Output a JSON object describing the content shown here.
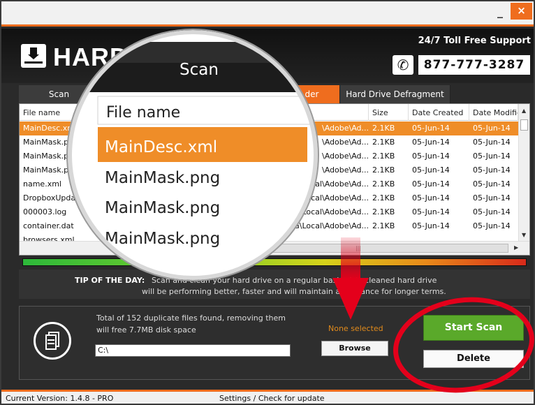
{
  "window": {
    "minimize": "_",
    "close": "×"
  },
  "header": {
    "logo_text": "HARD",
    "support": "24/7 Toll Free Support",
    "phone": "877-777-3287"
  },
  "tabs": [
    {
      "label": "Scan"
    },
    {
      "label": "der"
    },
    {
      "label": "Hard Drive Defragment"
    }
  ],
  "columns": [
    "File name",
    "Size",
    "Date Created",
    "Date Modifie"
  ],
  "files": [
    {
      "name": "MainDesc.xml",
      "path": "\\Adobe\\Ad...",
      "size": "2.1KB",
      "created": "05-Jun-14",
      "modified": "05-Jun-14"
    },
    {
      "name": "MainMask.pr",
      "path": "\\Adobe\\Ad...",
      "size": "2.1KB",
      "created": "05-Jun-14",
      "modified": "05-Jun-14"
    },
    {
      "name": "MainMask.pr",
      "path": "\\Adobe\\Ad...",
      "size": "2.1KB",
      "created": "05-Jun-14",
      "modified": "05-Jun-14"
    },
    {
      "name": "MainMask.pn",
      "path": "\\Adobe\\Ad...",
      "size": "2.1KB",
      "created": "05-Jun-14",
      "modified": "05-Jun-14"
    },
    {
      "name": "name.xml",
      "path": "al\\Adobe\\Ad...",
      "size": "2.1KB",
      "created": "05-Jun-14",
      "modified": "05-Jun-14"
    },
    {
      "name": "DropboxUpdate",
      "path": "Local\\Adobe\\Ad...",
      "size": "2.1KB",
      "created": "05-Jun-14",
      "modified": "05-Jun-14"
    },
    {
      "name": "000003.log",
      "path": "Local\\Adobe\\Ad...",
      "size": "2.1KB",
      "created": "05-Jun-14",
      "modified": "05-Jun-14"
    },
    {
      "name": "container.dat",
      "path": "ta\\Local\\Adobe\\Ad...",
      "size": "2.1KB",
      "created": "05-Jun-14",
      "modified": "05-Jun-14"
    },
    {
      "name": "browsers.xml",
      "path": "",
      "size": "",
      "created": "",
      "modified": ""
    }
  ],
  "zoom": {
    "tab": "Scan",
    "header": "File name",
    "rows": [
      "MainDesc.xml",
      "MainMask.png",
      "MainMask.png",
      "MainMask.png"
    ]
  },
  "tip": {
    "label": "TIP OF THE DAY:",
    "line1": "Scan and clean your hard drive on a regular basis. A      ly cleaned hard drive",
    "line2": "will be performing better, faster and will maintain a      formance for longer terms."
  },
  "bottom": {
    "summary_line1": "Total of 152 duplicate files found, removing them",
    "summary_line2": "will free 7.7MB disk space",
    "path_value": "C:\\",
    "selection_status": "None selected",
    "browse": "Browse",
    "start_scan": "Start Scan",
    "delete": "Delete"
  },
  "status": {
    "version": "Current Version: 1.4.8 - PRO",
    "settings": "Settings / Check for update"
  },
  "colors": {
    "accent": "#ef6d1e",
    "start": "#5aa92a",
    "annotation": "#e4001b"
  }
}
